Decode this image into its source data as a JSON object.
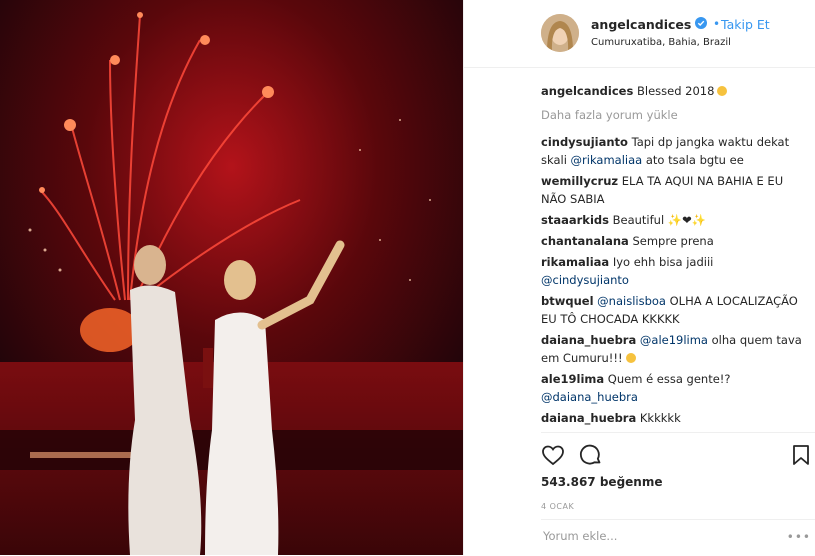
{
  "post": {
    "username": "angelcandices",
    "follow_separator": "•",
    "follow_label": "Takip Et",
    "location": "Cumuruxatiba, Bahia, Brazil",
    "caption_user": "angelcandices",
    "caption_text": "Blessed 2018",
    "load_more": "Daha fazla yorum yükle",
    "likes": "543.867 beğenme",
    "date": "4 OCAK",
    "comment_placeholder": "Yorum ekle...",
    "more_label": "•••"
  },
  "comments": [
    {
      "user": "cindysujianto",
      "pre": "Tapi dp jangka waktu dekat skali ",
      "mention": "@rikamaliaa",
      "post": " ato tsala bgtu ee"
    },
    {
      "user": "wemillycruz",
      "pre": "ELA TA AQUI NA BAHIA E EU NÃO SABIA",
      "mention": "",
      "post": ""
    },
    {
      "user": "staaarkids",
      "pre": "Beautiful ✨❤✨",
      "mention": "",
      "post": ""
    },
    {
      "user": "chantanalana",
      "pre": "Sempre prena",
      "mention": "",
      "post": ""
    },
    {
      "user": "rikamaliaa",
      "pre": "Iyo ehh bisa jadiii ",
      "mention": "@cindysujianto",
      "post": ""
    },
    {
      "user": "btwquel",
      "pre": "",
      "mention": "@naislisboa",
      "post": " OLHA A LOCALIZAÇÃO EU TÔ CHOCADA KKKKK"
    },
    {
      "user": "daiana_huebra",
      "pre": "",
      "mention": "@ale19lima",
      "post": " olha quem tava em Cumuru!!!"
    },
    {
      "user": "ale19lima",
      "pre": "Quem é essa gente!? ",
      "mention": "@daiana_huebra",
      "post": ""
    },
    {
      "user": "daiana_huebra",
      "pre": "Kkkkkk",
      "mention": "",
      "post": ""
    }
  ],
  "icons": {
    "verified": "verified-badge-icon",
    "like": "heart-icon",
    "comment": "comment-bubble-icon",
    "save": "bookmark-icon"
  },
  "colors": {
    "link_blue": "#3897f0",
    "mention_blue": "#003569",
    "muted": "#999999",
    "text": "#262626"
  }
}
